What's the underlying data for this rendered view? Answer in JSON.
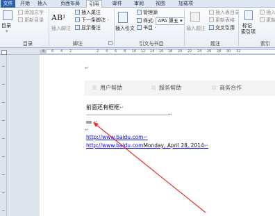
{
  "ribbon_tabs": [
    {
      "label": "文件",
      "state": "file"
    },
    {
      "label": "开始",
      "state": "normal"
    },
    {
      "label": "插入",
      "state": "normal"
    },
    {
      "label": "页面布局",
      "state": "normal"
    },
    {
      "label": "引用",
      "state": "active"
    },
    {
      "label": "邮件",
      "state": "normal"
    },
    {
      "label": "审阅",
      "state": "normal"
    },
    {
      "label": "视图",
      "state": "normal"
    },
    {
      "label": "加载项",
      "state": "normal"
    }
  ],
  "ribbon": {
    "toc": {
      "button": "目录",
      "add_text": "添加文字 ·",
      "update": "更新目录",
      "group": "目录"
    },
    "footnotes": {
      "big_icon_text": "AB¹",
      "insert_footnote": "插入脚注",
      "insert_endnote": "插入尾注",
      "next_footnote": "下一条脚注 ·",
      "show_notes": "显示备注",
      "group": "脚注"
    },
    "citations": {
      "insert_citation": "插入引文",
      "manage_sources": "管理源",
      "style_label": "样式:",
      "style_value": "APA 第五",
      "bibliography": "书目 ·",
      "group": "引文与书目"
    },
    "captions": {
      "insert_caption": "插入题注",
      "insert_table_of_figures": "插入表目录",
      "update_table": "更新表格",
      "cross_reference": "交叉引用",
      "group": "题注"
    },
    "index": {
      "mark_entry": "标记",
      "mark_entry_2": "索引项",
      "insert_index": "插入索",
      "update_index": "更新",
      "group": "索引"
    }
  },
  "ruler_numbers": [
    "8",
    "6",
    "4",
    "2",
    "",
    "2",
    "4",
    "6",
    "8",
    "10",
    "12",
    "14",
    "16",
    "18",
    "20",
    "22",
    "24",
    "26",
    "28",
    "30",
    "32"
  ],
  "document": {
    "paragraph_mark": "↵",
    "nav_items": [
      "用户帮助",
      "服务帮助",
      "商务合作"
    ],
    "heading": "前面还有框框",
    "link_1": "http://www.baidu.com",
    "link_2": "http://www.baidu.com",
    "link_2_suffix": "Monday, April 28, 2014"
  },
  "annotation": {
    "arrow_color": "#e8302a"
  }
}
